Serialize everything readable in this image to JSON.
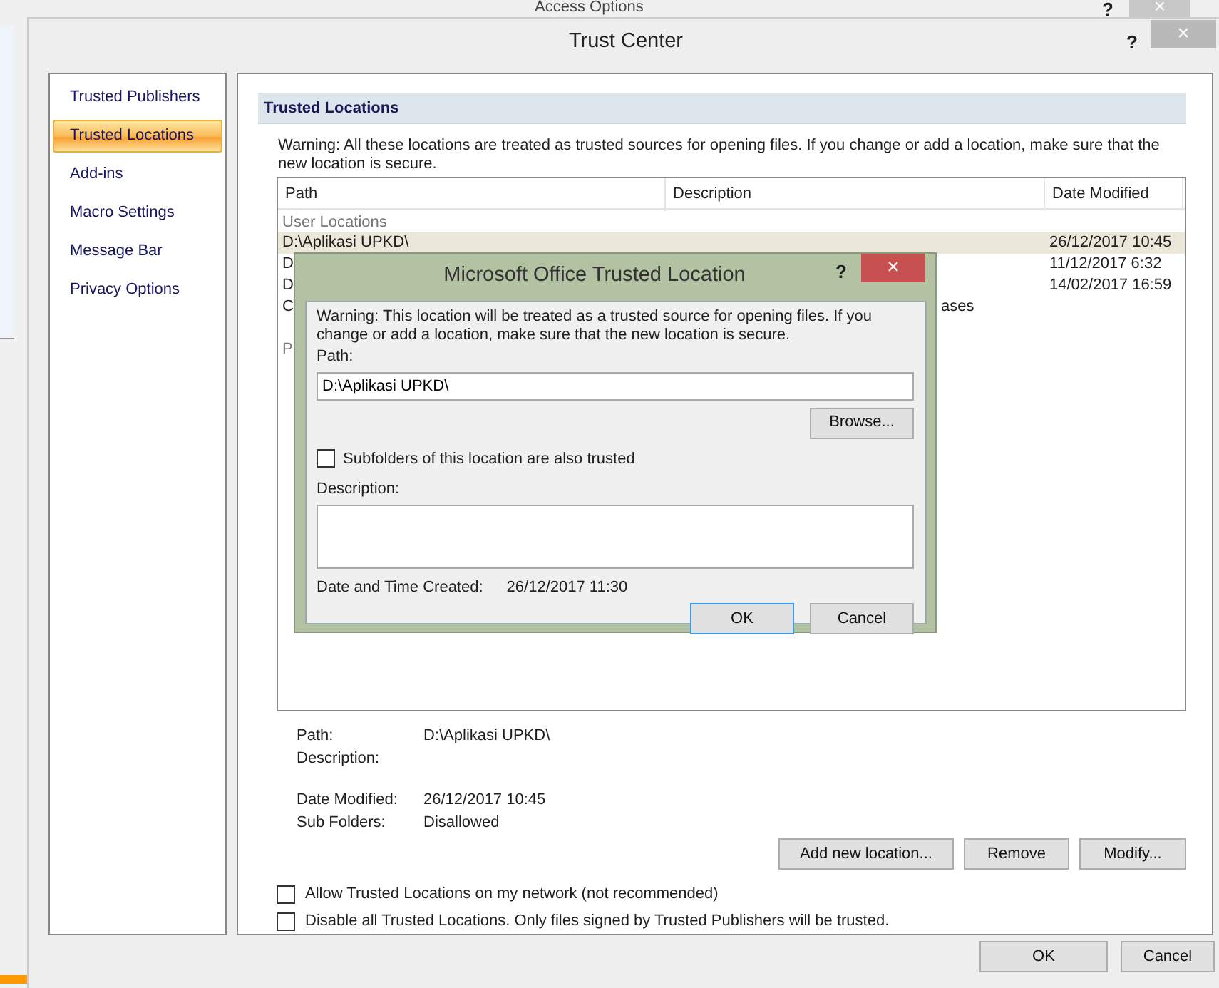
{
  "background_window": {
    "title": "Access Options",
    "help": "?",
    "close": "×"
  },
  "window": {
    "title": "Trust Center",
    "help": "?",
    "close": "×"
  },
  "sidebar": {
    "items": [
      {
        "label": "Trusted Publishers",
        "selected": false
      },
      {
        "label": "Trusted Locations",
        "selected": true
      },
      {
        "label": "Add-ins",
        "selected": false
      },
      {
        "label": "Macro Settings",
        "selected": false
      },
      {
        "label": "Message Bar",
        "selected": false
      },
      {
        "label": "Privacy Options",
        "selected": false
      }
    ]
  },
  "section": {
    "title": "Trusted Locations",
    "warning": "Warning: All these locations are treated as trusted sources for opening files.  If you change or add a location, make sure that the new location is secure."
  },
  "table": {
    "columns": [
      "Path",
      "Description",
      "Date Modified"
    ],
    "groups": [
      {
        "label": "User Locations",
        "rows": [
          {
            "path": "D:\\Aplikasi UPKD\\",
            "date_modified": "26/12/2017 10:45",
            "selected": true
          },
          {
            "path": "D",
            "date_modified": "11/12/2017 6:32",
            "selected": false
          },
          {
            "path": "D",
            "date_modified": "14/02/2017 16:59",
            "selected": false
          },
          {
            "path": "C",
            "description": "ases",
            "selected": false
          }
        ]
      },
      {
        "label": "P"
      }
    ]
  },
  "details": [
    [
      {
        "label": "Path:",
        "value": "D:\\Aplikasi UPKD\\"
      },
      {
        "label": "Description:"
      }
    ],
    [
      {
        "label": "Date Modified:",
        "value": "26/12/2017 10:45"
      },
      {
        "label": "Sub Folders:",
        "value": "Disallowed"
      }
    ]
  ],
  "location_buttons": [
    "Add new location...",
    "Remove",
    "Modify..."
  ],
  "options": [
    {
      "label": "Allow Trusted Locations on my network (not recommended)",
      "checked": false
    },
    {
      "label": "Disable all Trusted Locations. Only files signed by Trusted Publishers will be trusted.",
      "checked": false
    }
  ],
  "footer_buttons": [
    "OK",
    "Cancel"
  ],
  "dialog": {
    "title": "Microsoft Office Trusted Location",
    "help": "?",
    "close": "×",
    "warning": "Warning: This location will be treated as a trusted source for opening files. If you change or add a location, make sure that the new location is secure.",
    "path_label": "Path:",
    "path_value": "D:\\Aplikasi UPKD\\",
    "browse": "Browse...",
    "subfolders": {
      "label": "Subfolders of this location are also trusted",
      "checked": false
    },
    "description_label": "Description:",
    "created_label": "Date and Time Created:",
    "created_value": "26/12/2017 11:30",
    "buttons": [
      {
        "label": "OK",
        "default": true
      },
      {
        "label": "Cancel",
        "default": false
      }
    ]
  }
}
